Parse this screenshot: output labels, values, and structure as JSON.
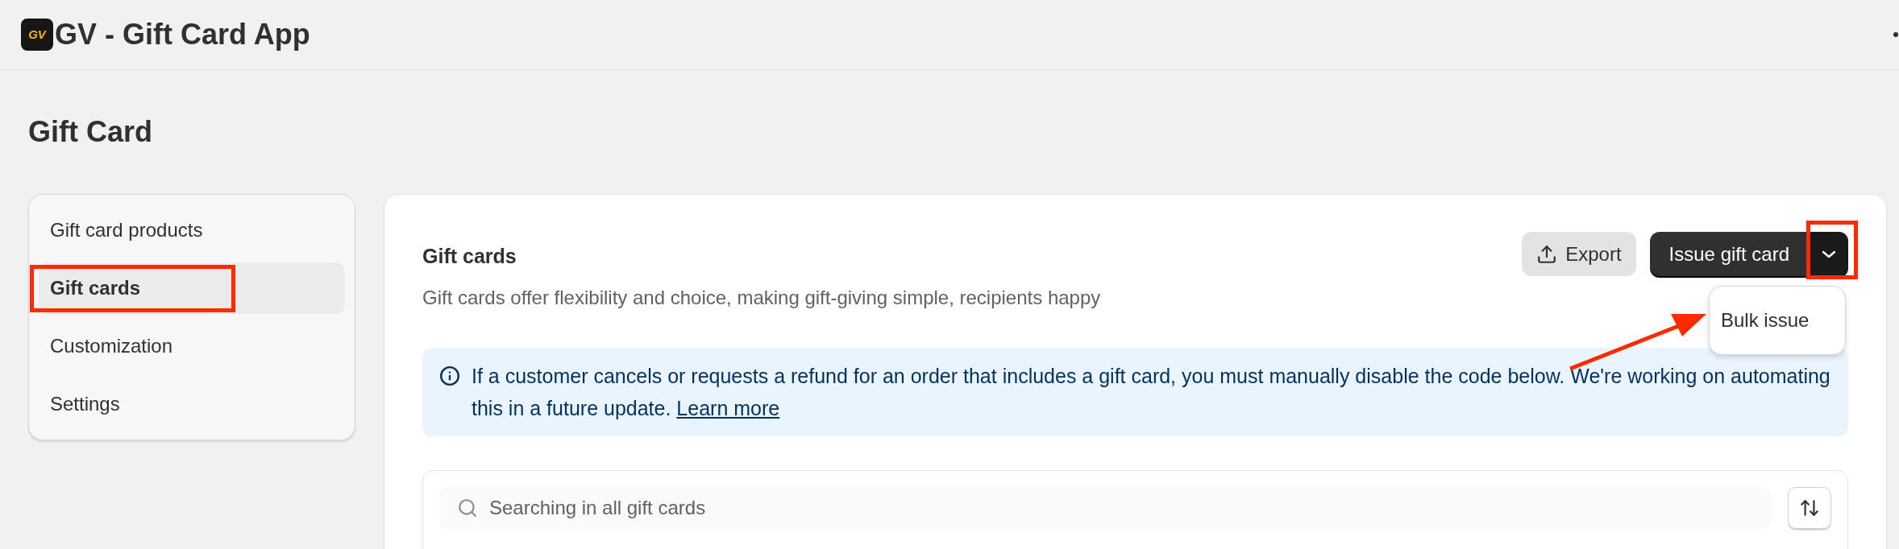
{
  "app": {
    "logo_text": "GV",
    "title": "GV - Gift Card App"
  },
  "page": {
    "title": "Gift Card"
  },
  "sidebar": {
    "items": [
      {
        "label": "Gift card products",
        "selected": false
      },
      {
        "label": "Gift cards",
        "selected": true
      },
      {
        "label": "Customization",
        "selected": false
      },
      {
        "label": "Settings",
        "selected": false
      }
    ]
  },
  "card": {
    "title": "Gift cards",
    "description": "Gift cards offer flexibility and choice, making gift-giving simple, recipients happy",
    "export_button": "Export",
    "primary_button": "Issue gift card",
    "dropdown": {
      "expanded": true,
      "items": [
        "Bulk issue"
      ]
    },
    "banner": {
      "text": "If a customer cancels or requests a refund for an order that includes a gift card, you must manually disable the code below. We're working on automating this in a future update.",
      "link": "Learn more"
    },
    "search": {
      "placeholder": "Searching in all gift cards"
    }
  }
}
